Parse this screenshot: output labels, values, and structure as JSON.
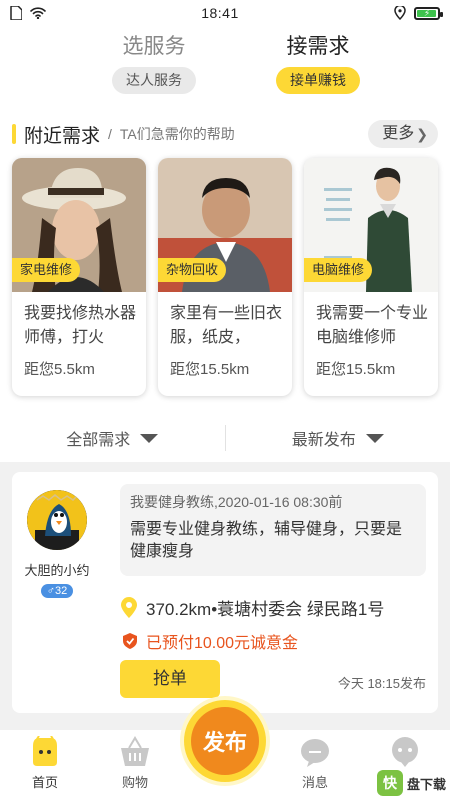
{
  "status_bar": {
    "time": "18:41"
  },
  "top_tabs": [
    {
      "title": "选服务",
      "pill": "达人服务",
      "active": false
    },
    {
      "title": "接需求",
      "pill": "接单赚钱",
      "active": true
    }
  ],
  "nearby": {
    "title": "附近需求",
    "separator": "/",
    "subtitle": "TA们急需你的帮助",
    "more_label": "更多"
  },
  "cards": [
    {
      "tag": "家电维修",
      "text": "我要找修热水器师傅，打火",
      "distance": "距您5.5km"
    },
    {
      "tag": "杂物回收",
      "text": "家里有一些旧衣服，纸皮，",
      "distance": "距您15.5km"
    },
    {
      "tag": "电脑维修",
      "text": "我需要一个专业电脑维修师",
      "distance": "距您15.5km"
    }
  ],
  "filters": {
    "all": "全部需求",
    "latest": "最新发布"
  },
  "post": {
    "username": "大胆的小约",
    "gender_age": "♂32",
    "meta": "我要健身教练,2020-01-16 08:30前",
    "body": "需要专业健身教练，辅导健身，只要是健康瘦身",
    "location": "370.2km•蓑塘村委会 绿民路1号",
    "paid": "已预付10.00元诚意金",
    "grab_label": "抢单",
    "time": "今天 18:15发布"
  },
  "bottom_nav": {
    "home": "首页",
    "shop": "购物",
    "publish": "发布",
    "messages": "消息"
  },
  "watermark": {
    "logo": "快",
    "text": "盘下载"
  },
  "colors": {
    "accent": "#fdd835",
    "publish": "#f0891d",
    "warning": "#e8541e",
    "badge": "#4a90e2"
  },
  "battery_level": 0.85
}
